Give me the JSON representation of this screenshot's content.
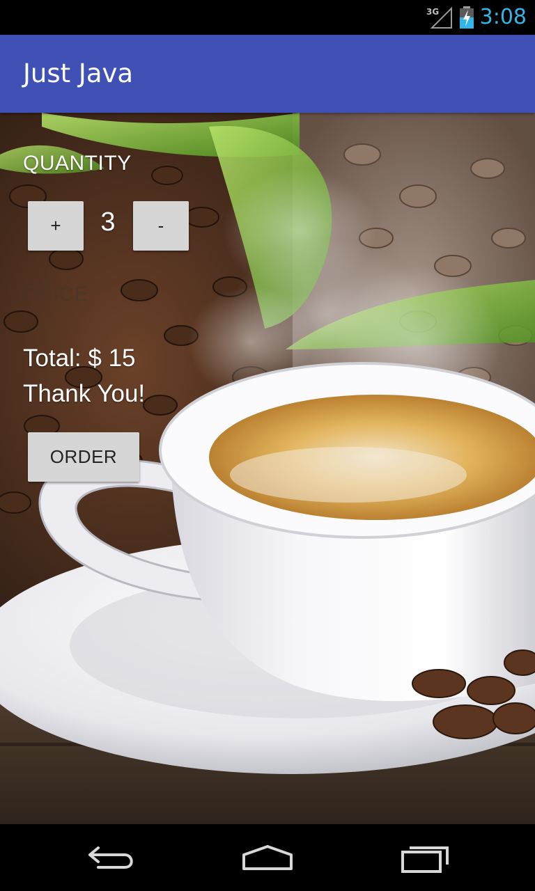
{
  "status_bar": {
    "network": "3G",
    "time": "3:08",
    "icons": [
      "signal-icon",
      "battery-charging-icon"
    ]
  },
  "app_bar": {
    "title": "Just Java",
    "color": "#3f51b5"
  },
  "order_form": {
    "quantity_label": "QUANTITY",
    "increment_label": "+",
    "decrement_label": "-",
    "quantity_value": "3",
    "price_label": "PRICE",
    "total_text": "Total: $  15",
    "thanks_text": "Thank You!",
    "order_button_label": "ORDER"
  },
  "nav_bar": {
    "icons": [
      "back-icon",
      "home-icon",
      "recents-icon"
    ]
  },
  "colors": {
    "status_clock": "#33b5e5",
    "button_bg": "#d6d6d6"
  }
}
